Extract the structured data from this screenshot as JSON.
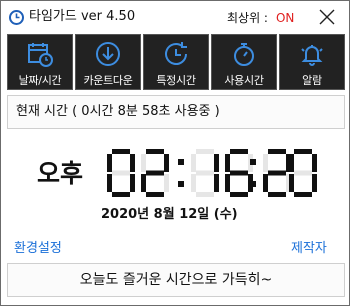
{
  "window": {
    "title": "타임가드 ver 4.50",
    "always_on_top_label": "최상위 :",
    "always_on_top_value": "ON"
  },
  "toolbar": {
    "items": [
      {
        "label": "날짜/시간",
        "icon": "calendar-icon"
      },
      {
        "label": "카운트다운",
        "icon": "download-arrow-icon"
      },
      {
        "label": "특정시간",
        "icon": "clock-refresh-icon"
      },
      {
        "label": "사용시간",
        "icon": "stopwatch-icon"
      },
      {
        "label": "알람",
        "icon": "bell-icon"
      }
    ]
  },
  "usage": {
    "text": "현재 시간 ( 0시간  8분 58초 사용중 )"
  },
  "clock": {
    "ampm": "오후",
    "hours": "02",
    "minutes": "16",
    "seconds": "20"
  },
  "date": {
    "text": "2020년  8월 12일 (수)"
  },
  "links": {
    "settings": "환경설정",
    "maker": "제작자"
  },
  "slogan": {
    "text": "오늘도 즐거운 시간으로 가득히~"
  },
  "colors": {
    "on": "#e0201f",
    "link": "#1a6fd8",
    "toolbar_bg": "#222222",
    "icon_blue": "#3d8de0",
    "digit_off": "#e6e6e6",
    "digit_on": "#111111"
  }
}
